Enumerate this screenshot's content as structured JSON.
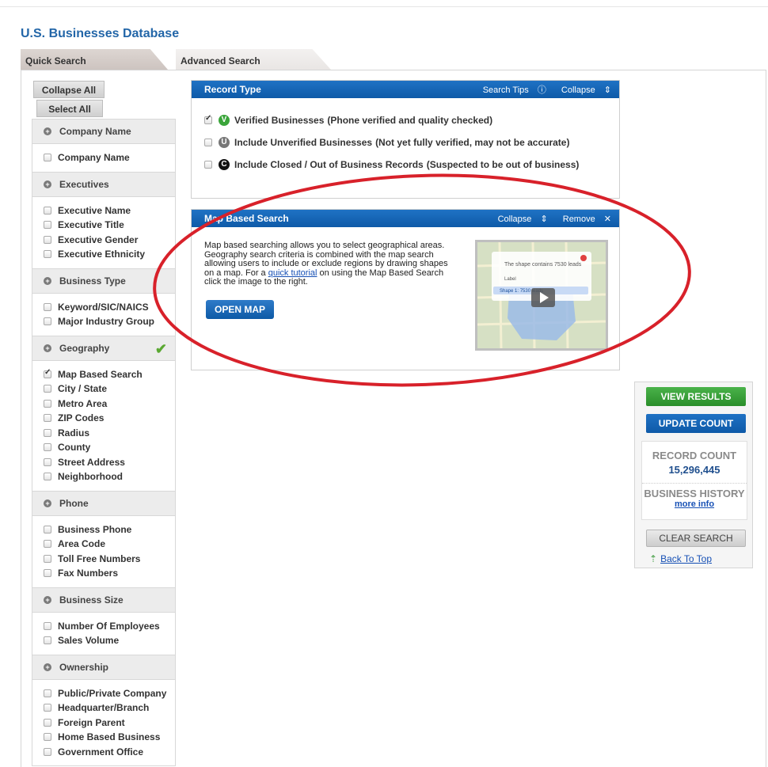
{
  "page": {
    "title": "U.S. Businesses Database"
  },
  "tabs": [
    {
      "label": "Quick Search",
      "active": true
    },
    {
      "label": "Advanced Search",
      "active": false
    }
  ],
  "sidebar": {
    "collapse_all": "Collapse All",
    "select_all": "Select All",
    "sections": [
      {
        "title": "Company Name",
        "options": [
          {
            "label": "Company Name",
            "checked": false
          }
        ]
      },
      {
        "title": "Executives",
        "options": [
          {
            "label": "Executive Name",
            "checked": false
          },
          {
            "label": "Executive Title",
            "checked": false
          },
          {
            "label": "Executive Gender",
            "checked": false
          },
          {
            "label": "Executive Ethnicity",
            "checked": false
          }
        ]
      },
      {
        "title": "Business Type",
        "options": [
          {
            "label": "Keyword/SIC/NAICS",
            "checked": false
          },
          {
            "label": "Major Industry Group",
            "checked": false
          }
        ]
      },
      {
        "title": "Geography",
        "active": true,
        "options": [
          {
            "label": "Map Based Search",
            "checked": true
          },
          {
            "label": "City / State",
            "checked": false
          },
          {
            "label": "Metro Area",
            "checked": false
          },
          {
            "label": "ZIP Codes",
            "checked": false
          },
          {
            "label": "Radius",
            "checked": false
          },
          {
            "label": "County",
            "checked": false
          },
          {
            "label": "Street Address",
            "checked": false
          },
          {
            "label": "Neighborhood",
            "checked": false
          }
        ]
      },
      {
        "title": "Phone",
        "options": [
          {
            "label": "Business Phone",
            "checked": false
          },
          {
            "label": "Area Code",
            "checked": false
          },
          {
            "label": "Toll Free Numbers",
            "checked": false
          },
          {
            "label": "Fax Numbers",
            "checked": false
          }
        ]
      },
      {
        "title": "Business Size",
        "options": [
          {
            "label": "Number Of Employees",
            "checked": false
          },
          {
            "label": "Sales Volume",
            "checked": false
          }
        ]
      },
      {
        "title": "Ownership",
        "options": [
          {
            "label": "Public/Private Company",
            "checked": false
          },
          {
            "label": "Headquarter/Branch",
            "checked": false
          },
          {
            "label": "Foreign Parent",
            "checked": false
          },
          {
            "label": "Home Based Business",
            "checked": false
          },
          {
            "label": "Government Office",
            "checked": false
          }
        ]
      }
    ]
  },
  "record_type": {
    "title": "Record Type",
    "search_tips": "Search Tips",
    "collapse": "Collapse",
    "rows": [
      {
        "badge": "V",
        "badge_color": "#3aa53a",
        "label": "Verified Businesses",
        "note": "(Phone verified and quality checked)",
        "checked": true
      },
      {
        "badge": "U",
        "badge_color": "#777777",
        "label": "Include Unverified Businesses",
        "note": "(Not yet fully verified, may not be accurate)",
        "checked": false
      },
      {
        "badge": "C",
        "badge_color": "#111111",
        "label": "Include Closed / Out of Business Records",
        "note": "(Suspected to be out of business)",
        "checked": false
      }
    ]
  },
  "map_search": {
    "title": "Map Based Search",
    "collapse": "Collapse",
    "remove": "Remove",
    "desc_before": "Map based searching allows you to select geographical areas. Geography search criteria is combined with the map search allowing users to include or exclude regions by drawing shapes on a map. For a ",
    "desc_link": "quick tutorial",
    "desc_after": " on using the Map Based Search click the image to the right.",
    "open_map": "OPEN MAP",
    "thumb_text": "The shape contains 7530 leads",
    "thumb_label": "Label",
    "thumb_shape": "Shape 1: 7530 leads"
  },
  "results": {
    "view_results": "VIEW RESULTS",
    "update_count": "UPDATE COUNT",
    "record_count_label": "RECORD COUNT",
    "record_count": "15,296,445",
    "history_label": "BUSINESS HISTORY",
    "more_info": "more info",
    "clear_search": "CLEAR SEARCH",
    "back_to_top": "Back To Top"
  }
}
